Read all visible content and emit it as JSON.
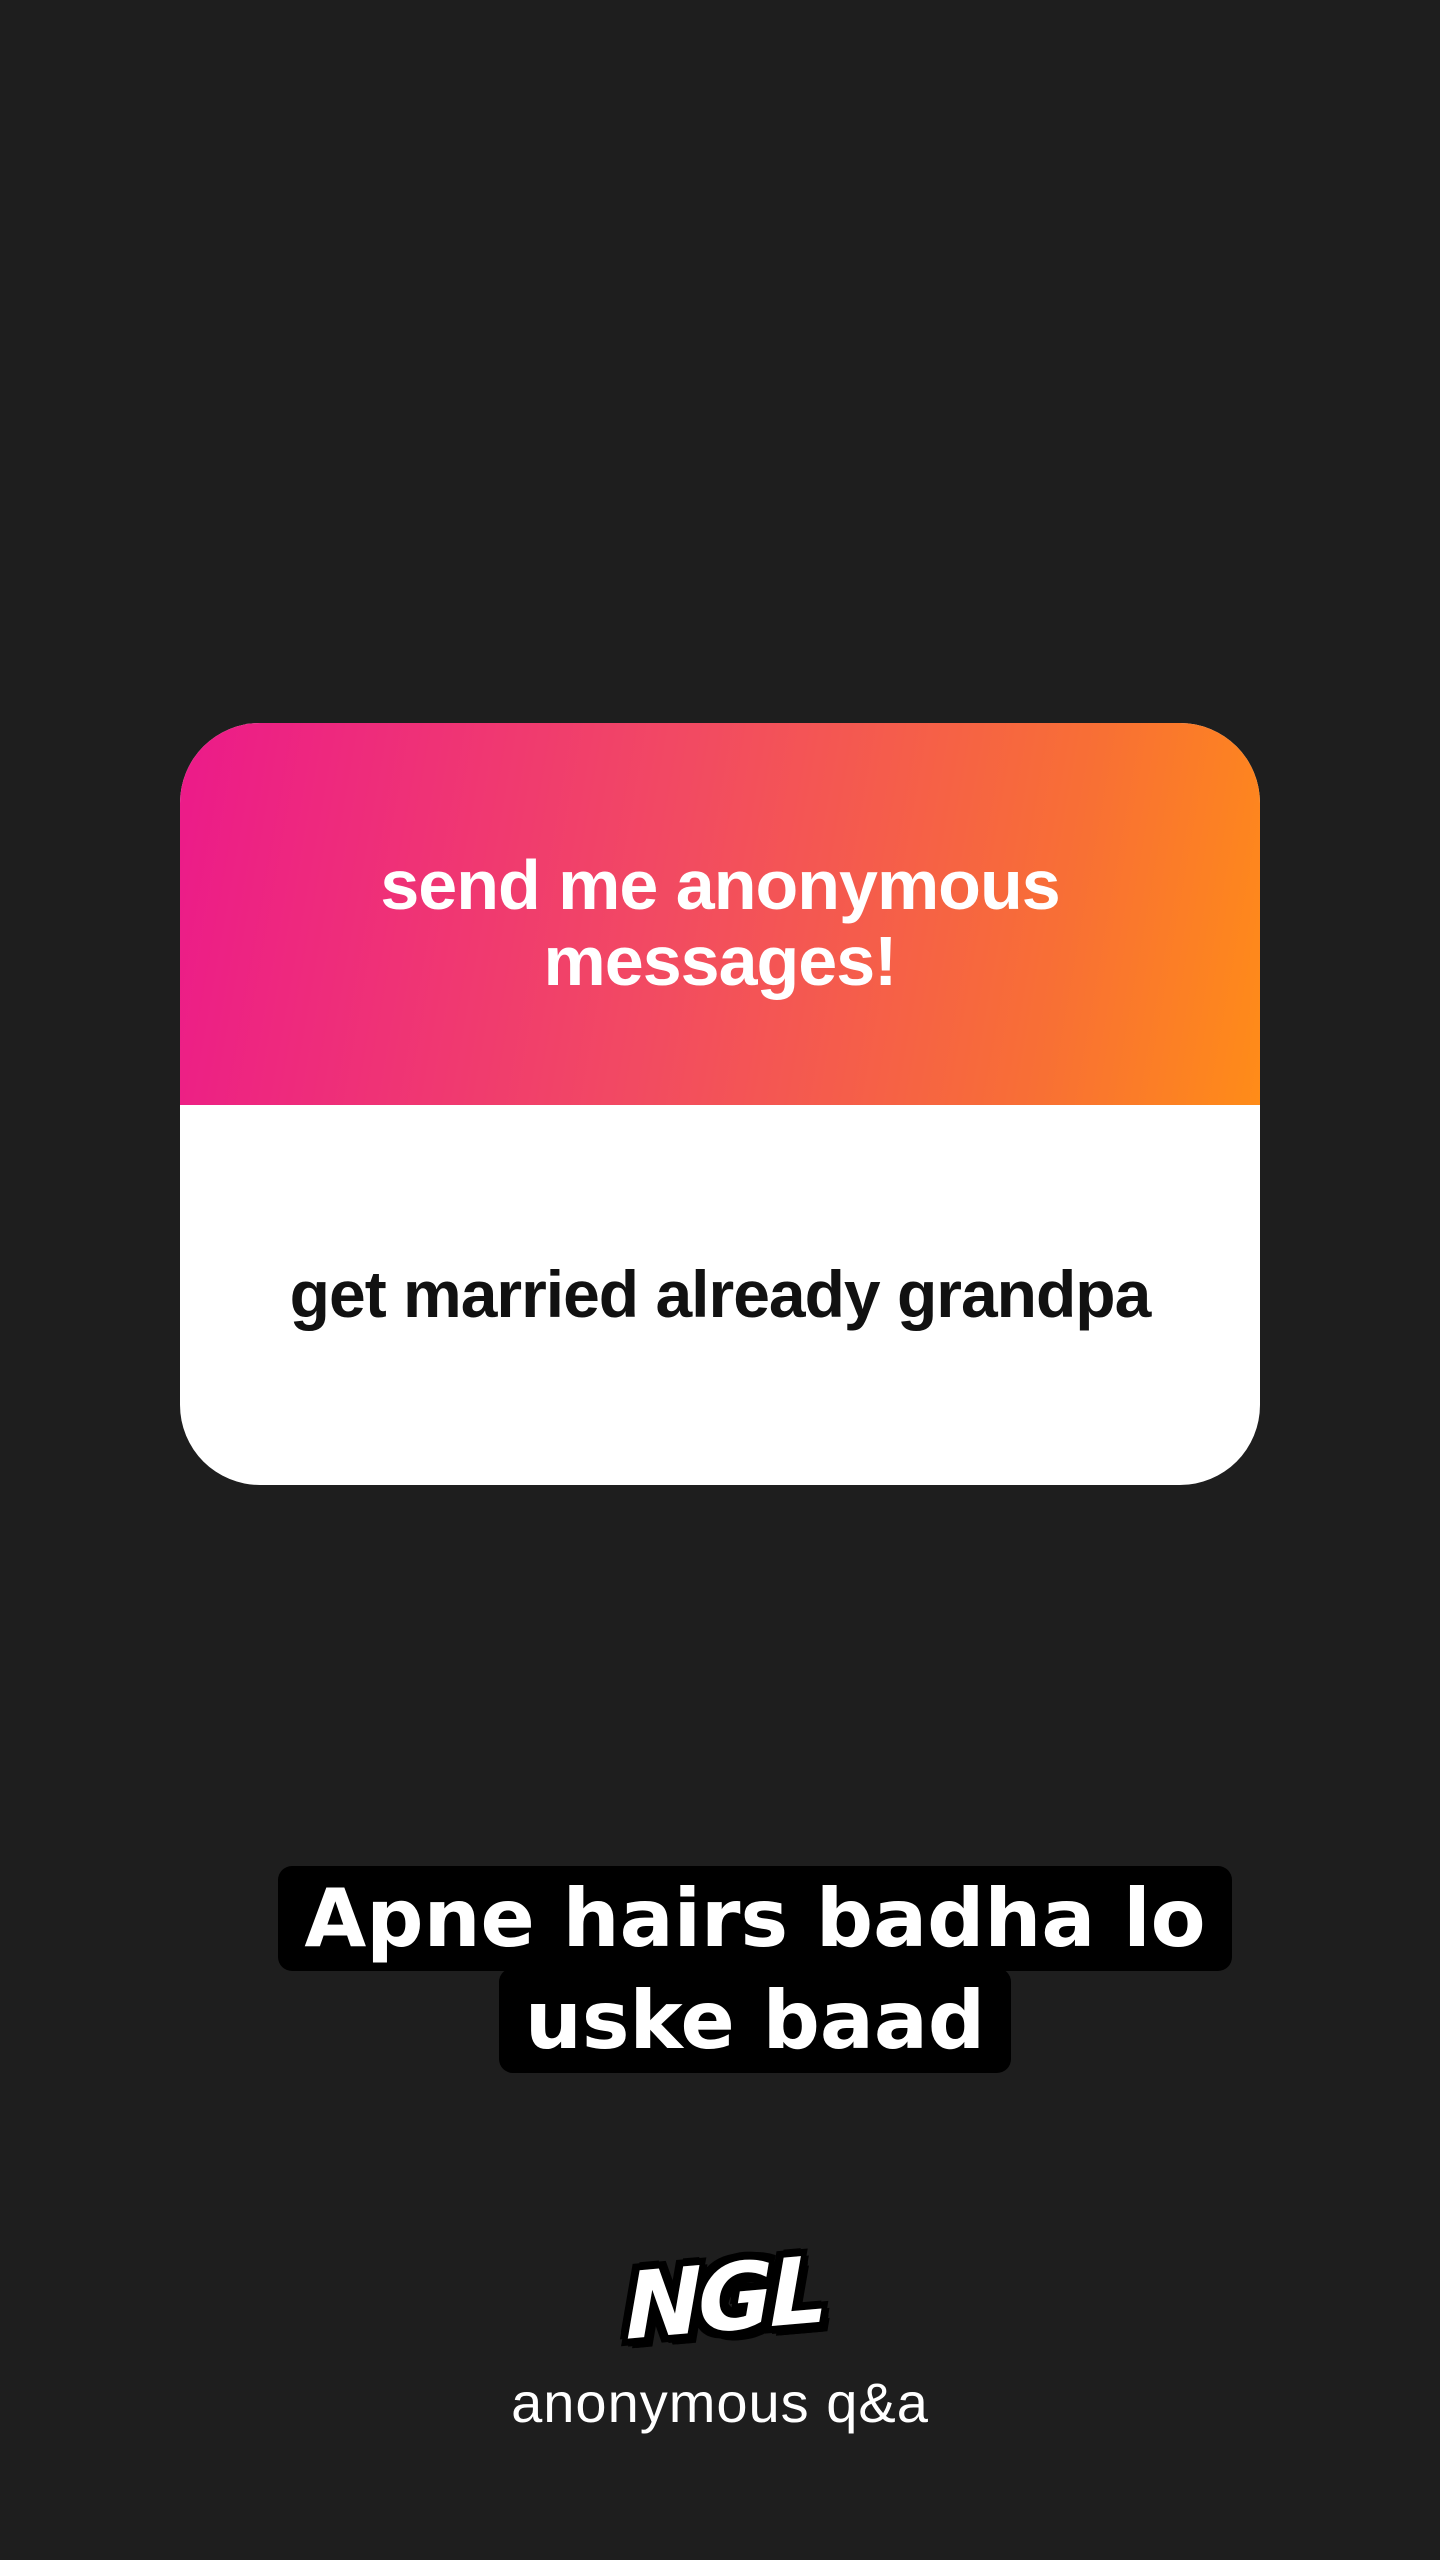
{
  "card": {
    "header_text": "send me anonymous messages!",
    "question_text": "get married already grandpa"
  },
  "reply": {
    "caption_text": "Apne hairs badha lo uske baad"
  },
  "branding": {
    "logo_text": "NGL",
    "tagline": "anonymous q&a"
  },
  "colors": {
    "background": "#1e1e1e",
    "gradient_start": "#ec1a8a",
    "gradient_end": "#ff8c18",
    "card_body": "#ffffff",
    "caption_background": "#000000"
  }
}
